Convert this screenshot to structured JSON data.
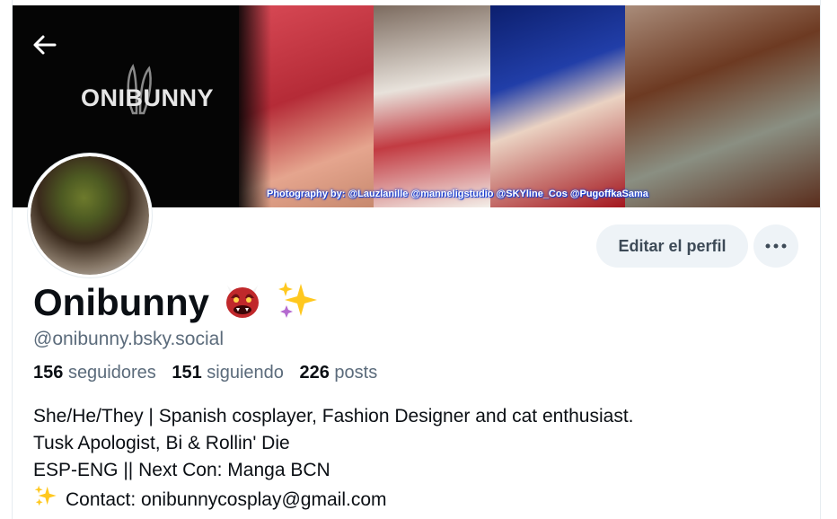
{
  "banner": {
    "logo_text": "ONIBUNNY",
    "credit": "Photography by: @Lauzlanille  @manneligstudio  @SKYline_Cos  @PugoffkaSama"
  },
  "header": {
    "back_icon": "arrow-left-icon"
  },
  "actions": {
    "edit_label": "Editar el perfil",
    "more_icon": "ellipsis-icon"
  },
  "profile": {
    "display_name": "Onibunny",
    "name_emojis": [
      "ogre-emoji",
      "sparkles-emoji"
    ],
    "handle": "@onibunny.bsky.social"
  },
  "stats": {
    "followers_count": "156",
    "followers_label": "seguidores",
    "following_count": "151",
    "following_label": "siguiendo",
    "posts_count": "226",
    "posts_label": "posts"
  },
  "bio": {
    "line1": "She/He/They | Spanish cosplayer, Fashion Designer and cat enthusiast.",
    "line2": "Tusk Apologist, Bi & Rollin' Die",
    "line3": "ESP-ENG || Next Con: Manga BCN",
    "line4": "Contact: onibunnycosplay@gmail.com"
  },
  "colors": {
    "button_bg": "#eef3f7",
    "text_primary": "#0b0f14",
    "text_secondary": "#5b6b7b"
  }
}
